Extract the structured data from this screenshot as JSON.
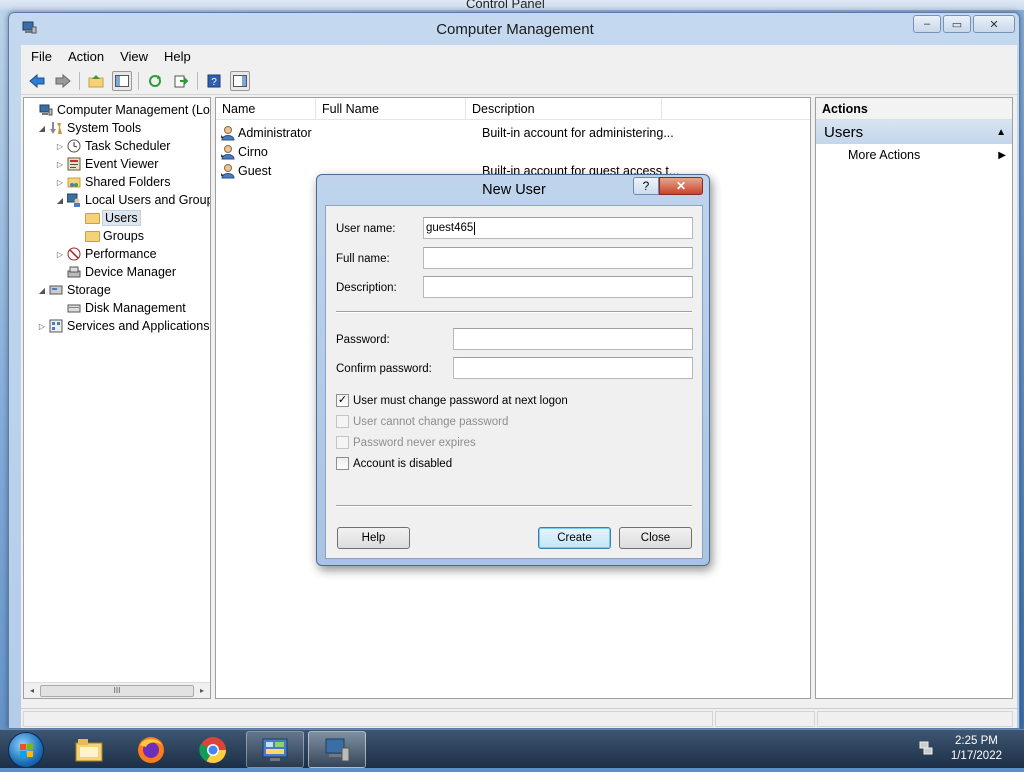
{
  "background_window": {
    "title": "Control Panel"
  },
  "window": {
    "title": "Computer Management",
    "controls": {
      "minimize": "–",
      "maximize": "▭",
      "close": "✕"
    }
  },
  "menu": [
    "File",
    "Action",
    "View",
    "Help"
  ],
  "toolbar_icons": [
    "back-arrow-icon",
    "forward-arrow-icon",
    "up-folder-icon",
    "show-hide-tree-icon",
    "refresh-icon",
    "export-list-icon",
    "help-icon",
    "show-hide-action-pane-icon"
  ],
  "tree": [
    {
      "label": "Computer Management (Local",
      "level": 0,
      "expander": "",
      "icon": "computer-management-icon"
    },
    {
      "label": "System Tools",
      "level": 1,
      "expander": "◢",
      "icon": "system-tools-icon"
    },
    {
      "label": "Task Scheduler",
      "level": 2,
      "expander": "▷",
      "icon": "task-scheduler-icon"
    },
    {
      "label": "Event Viewer",
      "level": 2,
      "expander": "▷",
      "icon": "event-viewer-icon"
    },
    {
      "label": "Shared Folders",
      "level": 2,
      "expander": "▷",
      "icon": "shared-folders-icon"
    },
    {
      "label": "Local Users and Groups",
      "level": 2,
      "expander": "◢",
      "icon": "local-users-groups-icon"
    },
    {
      "label": "Users",
      "level": 3,
      "expander": "",
      "icon": "folder-icon",
      "selected": true
    },
    {
      "label": "Groups",
      "level": 3,
      "expander": "",
      "icon": "folder-icon"
    },
    {
      "label": "Performance",
      "level": 2,
      "expander": "▷",
      "icon": "performance-icon"
    },
    {
      "label": "Device Manager",
      "level": 2,
      "expander": "",
      "icon": "device-manager-icon"
    },
    {
      "label": "Storage",
      "level": 1,
      "expander": "◢",
      "icon": "storage-icon"
    },
    {
      "label": "Disk Management",
      "level": 2,
      "expander": "",
      "icon": "disk-management-icon"
    },
    {
      "label": "Services and Applications",
      "level": 1,
      "expander": "▷",
      "icon": "services-applications-icon"
    }
  ],
  "tree_scroll": {
    "left": "◂",
    "thumb": "III",
    "right": "▸"
  },
  "list": {
    "columns": [
      "Name",
      "Full Name",
      "Description"
    ],
    "rows": [
      {
        "name": "Administrator",
        "full_name": "",
        "description": "Built-in account for administering..."
      },
      {
        "name": "Cirno",
        "full_name": "",
        "description": ""
      },
      {
        "name": "Guest",
        "full_name": "",
        "description": "Built-in account for guest access t..."
      }
    ]
  },
  "actions": {
    "header": "Actions",
    "section": "Users",
    "section_arrow": "▲",
    "items": [
      {
        "label": "More Actions",
        "arrow": "▶"
      }
    ]
  },
  "dialog": {
    "title": "New User",
    "help_glyph": "?",
    "close_glyph": "✕",
    "fields": {
      "username_label": "User name:",
      "username_value": "guest465",
      "fullname_label": "Full name:",
      "fullname_value": "",
      "description_label": "Description:",
      "description_value": "",
      "password_label": "Password:",
      "password_value": "",
      "confirm_label": "Confirm password:",
      "confirm_value": ""
    },
    "checkboxes": [
      {
        "label": "User must change password at next logon",
        "checked": true,
        "enabled": true
      },
      {
        "label": "User cannot change password",
        "checked": false,
        "enabled": false
      },
      {
        "label": "Password never expires",
        "checked": false,
        "enabled": false
      },
      {
        "label": "Account is disabled",
        "checked": false,
        "enabled": true
      }
    ],
    "buttons": {
      "help": "Help",
      "create": "Create",
      "close": "Close"
    }
  },
  "taskbar": {
    "apps": [
      "file-explorer-icon",
      "firefox-icon",
      "chrome-icon",
      "control-panel-icon",
      "computer-management-icon"
    ],
    "time": "2:25 PM",
    "date": "1/17/2022",
    "tray_icon": "network-icon"
  },
  "colors": {
    "accent": "#3c7fb1",
    "selection": "#dde5ee",
    "dialog_close": "#c8442a"
  }
}
